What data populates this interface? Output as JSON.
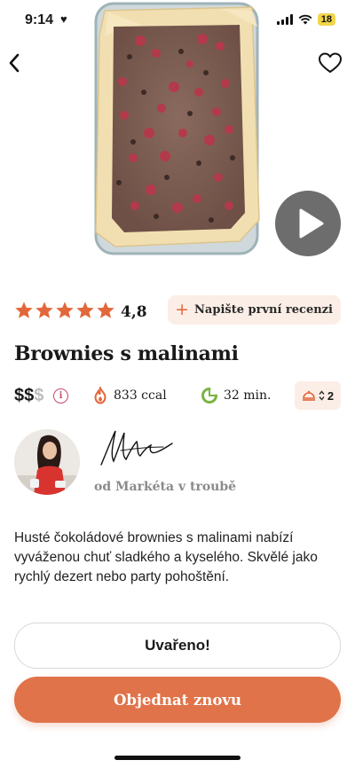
{
  "status_bar": {
    "time": "9:14",
    "battery": "18"
  },
  "hero": {
    "image_alt": "brownies with raspberries in baking dish"
  },
  "rating": {
    "stars": 5,
    "value": "4,8",
    "star_color": "#e2673a"
  },
  "review_button": {
    "label": "Napište první recenzi"
  },
  "recipe": {
    "title": "Brownies s malinami",
    "price_active": "$$",
    "price_inactive": "$",
    "calories": "833 ccal",
    "time": "32 min.",
    "servings": "2"
  },
  "author": {
    "name": "od Markéta v troubě"
  },
  "description": "Husté čokoládové brownies s malinami nabízí vyváženou chuť sladkého a kyselého. Skvělé jako rychlý dezert nebo party pohoštění.",
  "actions": {
    "cooked_label": "Uvařeno!",
    "order_label": "Objednat znovu"
  },
  "colors": {
    "accent": "#e0734a",
    "chip_bg": "#fbeee6",
    "time_icon": "#7cb342",
    "kcal_icon": "#e2673a"
  },
  "icons": {
    "back": "chevron-left-icon",
    "favorite": "heart-outline-icon",
    "play": "play-icon",
    "kcal": "flame-icon",
    "time": "timer-icon",
    "servings": "cloche-icon"
  }
}
